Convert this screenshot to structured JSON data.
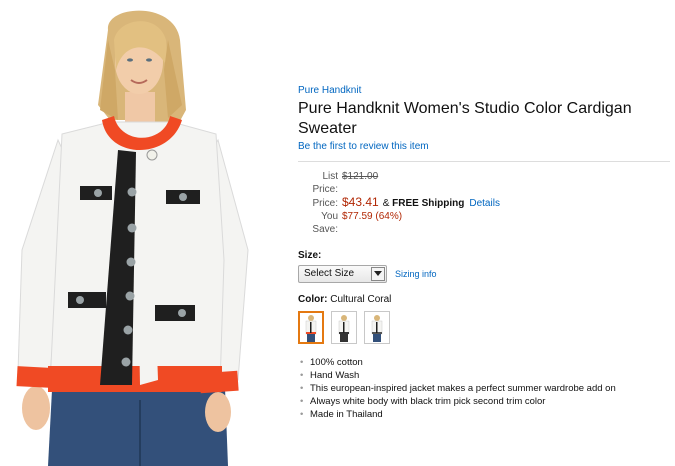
{
  "product": {
    "brand": "Pure Handknit",
    "title": "Pure Handknit Women's Studio Color Cardigan Sweater",
    "review_link": "Be the first to review this item",
    "image_alt": "Woman wearing white cardigan with black trim and coral collar and cuffs"
  },
  "pricing": {
    "list_price_label": "List Price:",
    "list_price": "$121.00",
    "price_label": "Price:",
    "price": "$43.41",
    "shipping_prefix": "&",
    "shipping": "FREE Shipping",
    "details_link": "Details",
    "savings_label": "You Save:",
    "savings": "$77.59 (64%)"
  },
  "size": {
    "label": "Size:",
    "selected": "Select Size",
    "sizing_link": "Sizing info"
  },
  "color": {
    "label": "Color:",
    "selected": "Cultural Coral",
    "swatch_count": 3
  },
  "features": [
    "100% cotton",
    "Hand Wash",
    "This european-inspired jacket makes a perfect summer wardrobe add on",
    "Always white body with black trim pick second trim color",
    "Made in Thailand"
  ],
  "colors": {
    "link": "#0066c0",
    "price": "#b12704",
    "selected_border": "#e47911",
    "sweater_body": "#f4f4f2",
    "coral_trim": "#f04a24",
    "black_trim": "#1f1f1f",
    "jeans": "#33507a"
  },
  "icons": {
    "select_arrow": "chevron-down-icon"
  }
}
